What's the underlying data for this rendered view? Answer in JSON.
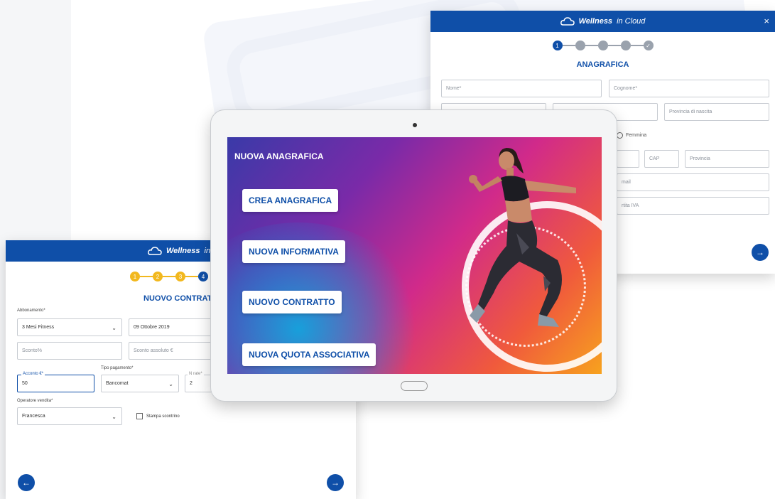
{
  "brand": {
    "name_bold": "Wellness",
    "name_rest": "in Cloud"
  },
  "colors": {
    "primary": "#0f4fa8",
    "step_yellow": "#f2b81e",
    "step_grey": "#9aa2ad"
  },
  "anagrafica": {
    "close_label": "×",
    "steps": [
      "1",
      "",
      "",
      "",
      ""
    ],
    "title": "ANAGRAFICA",
    "fields": {
      "nome": "Nome*",
      "cognome": "Cognome*",
      "data_nascita": "",
      "comune_nascita": "",
      "provincia_nascita": "Provincia di nascita",
      "indirizzo": "",
      "cap": "CAP",
      "provincia": "Provincia",
      "email": "mail",
      "partita_iva": "rtita IVA"
    },
    "radio_femmina": "Femmina",
    "next_icon": "→"
  },
  "contratto": {
    "steps": [
      "1",
      "2",
      "3",
      "4"
    ],
    "title": "NUOVO CONTRATT",
    "abbonamento_label": "Abbonamento*",
    "abbonamento_value": "3 Mesi Fitness",
    "data_value": "09 Ottobre 2019",
    "sconto_percent": "Sconto%",
    "sconto_assoluto": "Sconto assoluto €",
    "tipo_pagamento_label": "Tipo pagamento*",
    "acconto_label": "Acconto €*",
    "acconto_value": "50",
    "pagamento_value": "Bancomat",
    "rate_label": "N rate*",
    "rate_value": "2",
    "operatore_label": "Operatore vendita*",
    "operatore_value": "Francesca",
    "stampa_label": "Stampa scontrino",
    "prev_icon": "←",
    "next_icon": "→"
  },
  "tablet": {
    "screen_title": "NUOVA ANAGRAFICA",
    "buttons": [
      "CREA ANAGRAFICA",
      "NUOVA INFORMATIVA",
      "NUOVO CONTRATTO",
      "NUOVA QUOTA ASSOCIATIVA"
    ]
  }
}
